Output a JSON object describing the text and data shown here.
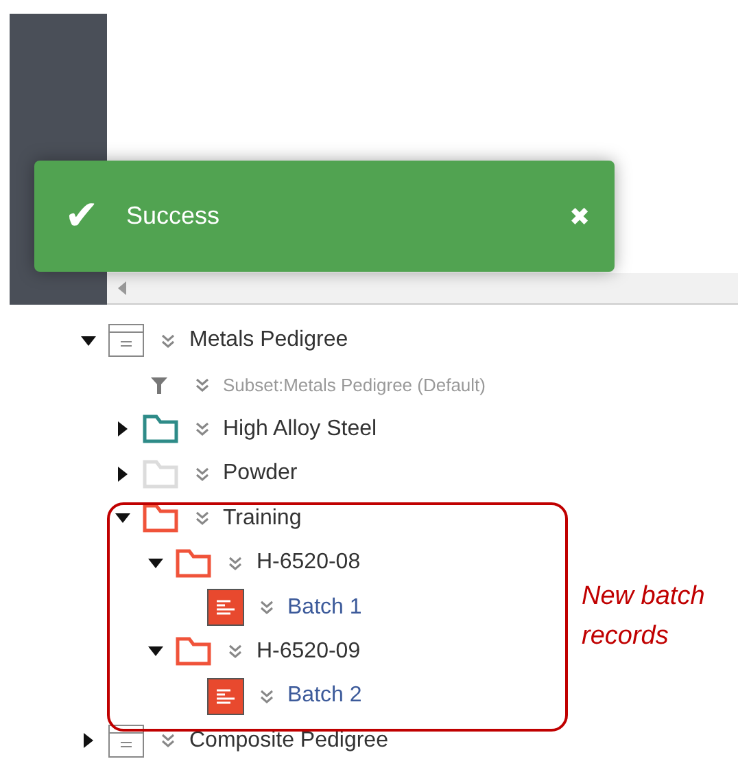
{
  "toast": {
    "message": "Success",
    "icon": "✔",
    "close": "✖"
  },
  "tree": [
    {
      "label": "Metals Pedigree",
      "kind": "pedigree",
      "expanded": true,
      "children": [
        {
          "label": "Subset:Metals Pedigree (Default)",
          "kind": "subset"
        },
        {
          "label": "High Alloy Steel",
          "kind": "folder",
          "color": "#2e8b88",
          "expanded": false
        },
        {
          "label": "Powder",
          "kind": "folder",
          "color": "#dcdcdc",
          "expanded": false
        },
        {
          "label": "Training",
          "kind": "folder",
          "color": "#f0533a",
          "expanded": true,
          "children": [
            {
              "label": "H-6520-08",
              "kind": "folder",
              "color": "#f0533a",
              "expanded": true,
              "children": [
                {
                  "label": "Batch 1",
                  "kind": "batch"
                }
              ]
            },
            {
              "label": "H-6520-09",
              "kind": "folder",
              "color": "#f0533a",
              "expanded": true,
              "children": [
                {
                  "label": "Batch 2",
                  "kind": "batch"
                }
              ]
            }
          ]
        }
      ]
    },
    {
      "label": "Composite Pedigree",
      "kind": "pedigree",
      "expanded": false
    }
  ],
  "annotation": {
    "text": "New batch records"
  }
}
